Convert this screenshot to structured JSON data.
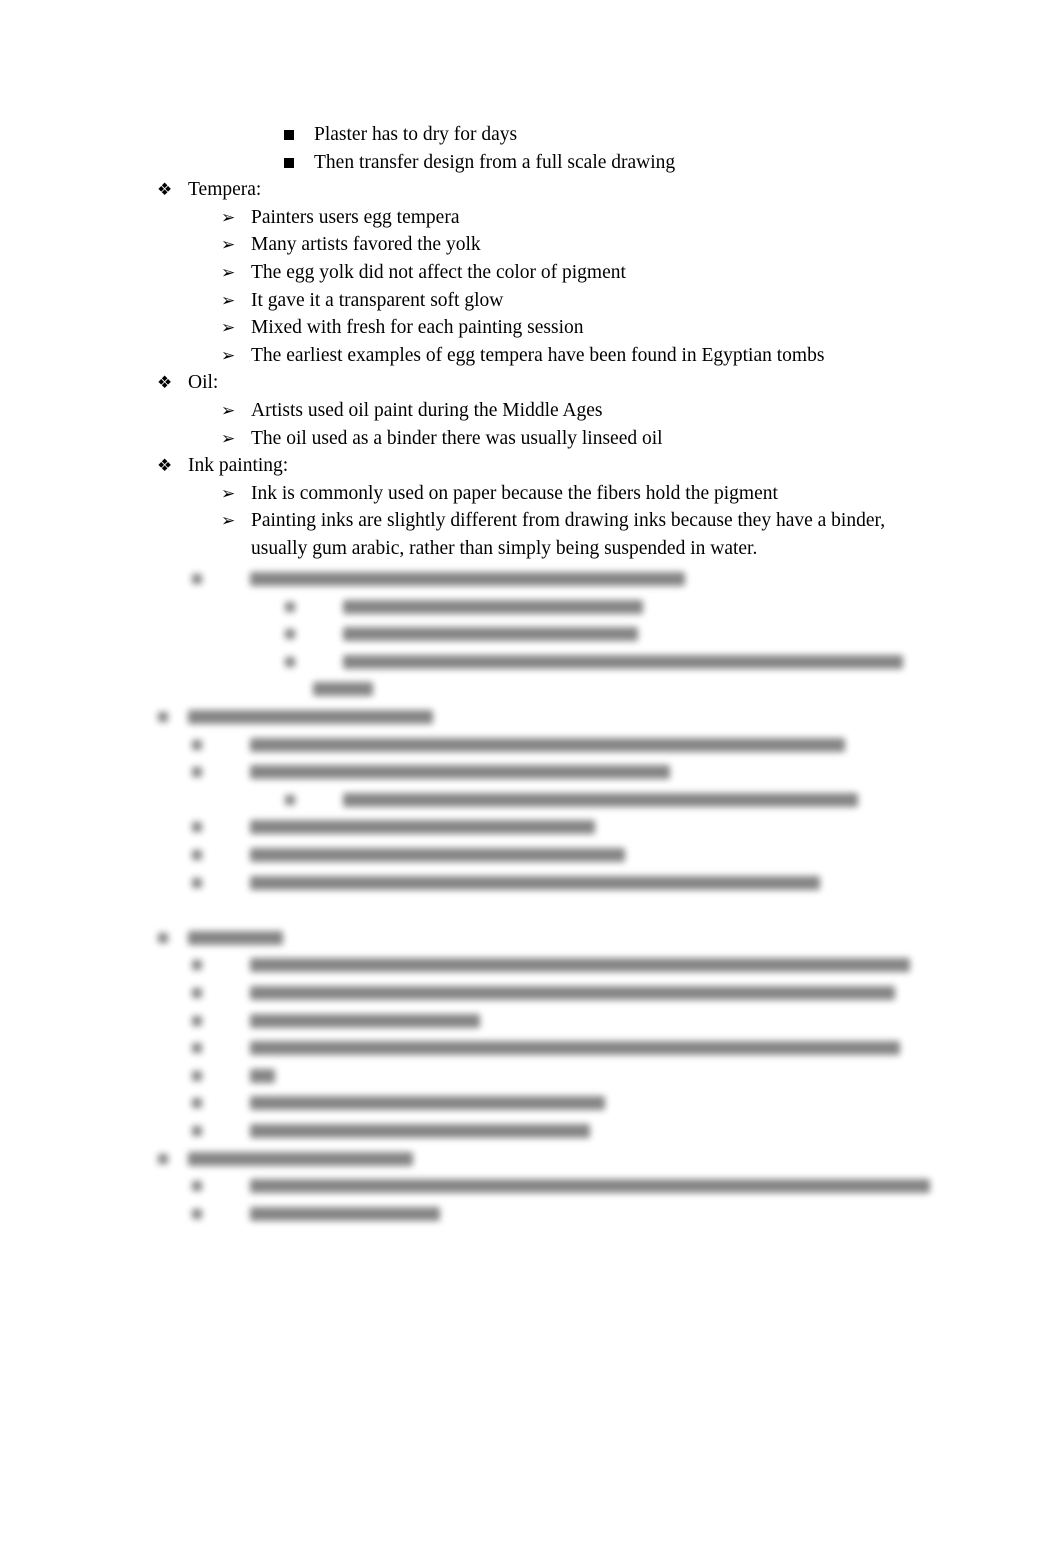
{
  "document": {
    "items": [
      {
        "level": 3,
        "bullet": "square",
        "text": "Plaster has to dry for days"
      },
      {
        "level": 3,
        "bullet": "square",
        "text": "Then transfer design from a full scale drawing"
      },
      {
        "level": 1,
        "bullet": "diamond",
        "text": "Tempera:"
      },
      {
        "level": 2,
        "bullet": "arrow",
        "text": "Painters users egg tempera"
      },
      {
        "level": 2,
        "bullet": "arrow",
        "text": "Many artists favored the yolk"
      },
      {
        "level": 2,
        "bullet": "arrow",
        "text": "The egg yolk did not affect the color of pigment"
      },
      {
        "level": 2,
        "bullet": "arrow",
        "text": "It gave it a transparent soft glow"
      },
      {
        "level": 2,
        "bullet": "arrow",
        "text": "Mixed with fresh for each painting session"
      },
      {
        "level": 2,
        "bullet": "arrow",
        "text": "The earliest examples of egg tempera have been found in Egyptian tombs"
      },
      {
        "level": 1,
        "bullet": "diamond",
        "text": "Oil:"
      },
      {
        "level": 2,
        "bullet": "arrow",
        "text": "Artists used oil paint during the Middle Ages"
      },
      {
        "level": 2,
        "bullet": "arrow",
        "text": "The oil used as a binder there was usually linseed oil"
      },
      {
        "level": 1,
        "bullet": "diamond",
        "text": "Ink painting:"
      },
      {
        "level": 2,
        "bullet": "arrow",
        "text": "Ink is commonly used on paper because the fibers hold the pigment"
      },
      {
        "level": 2,
        "bullet": "arrow",
        "text": "Painting inks are slightly different from drawing inks because they have a binder,"
      },
      {
        "level": 2,
        "bullet": "none",
        "text": "usually gum arabic, rather than simply being suspended in water."
      }
    ],
    "bullets": {
      "diamond": "❖",
      "arrow": "➢"
    },
    "blurred_section_label": "obscured-content"
  }
}
